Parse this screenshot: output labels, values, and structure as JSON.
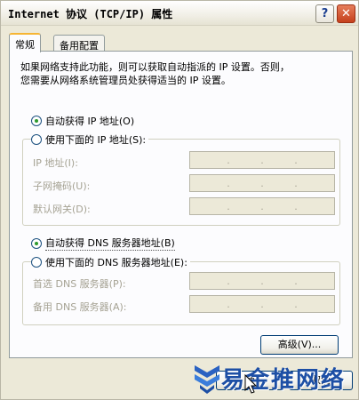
{
  "window": {
    "title": "Internet 协议 (TCP/IP) 属性",
    "help_label": "?",
    "close_label": "✕",
    "help_icon": "question-icon",
    "close_icon": "close-icon"
  },
  "tabs": [
    {
      "label": "常规",
      "active": true
    },
    {
      "label": "备用配置",
      "active": false
    }
  ],
  "intro_text": "如果网络支持此功能，则可以获取自动指派的 IP 设置。否则，\n您需要从网络系统管理员处获得适当的 IP 设置。",
  "ip": {
    "auto_label": "自动获得 IP 地址(O)",
    "auto_checked": true,
    "manual_label": "使用下面的 IP 地址(S):",
    "manual_checked": false,
    "fields": [
      {
        "label": "IP 地址(I):"
      },
      {
        "label": "子网掩码(U):"
      },
      {
        "label": "默认网关(D):"
      }
    ]
  },
  "dns": {
    "auto_label": "自动获得 DNS 服务器地址(B)",
    "auto_checked": true,
    "manual_label": "使用下面的 DNS 服务器地址(E):",
    "manual_checked": false,
    "fields": [
      {
        "label": "首选 DNS 服务器(P):"
      },
      {
        "label": "备用 DNS 服务器(A):"
      }
    ]
  },
  "buttons": {
    "advanced_label": "高级(V)...",
    "ok_label": "确",
    "cancel_label": "取消"
  },
  "watermark": {
    "text": "易金推网络"
  },
  "colors": {
    "window_bg": "#ece9d8",
    "panel_bg": "#fcfcfe",
    "active_tab_accent": "#f6b533",
    "radio_dot": "#2e9a2e",
    "close_button": "#c5401c",
    "watermark_blue": "#1d4fa5"
  }
}
